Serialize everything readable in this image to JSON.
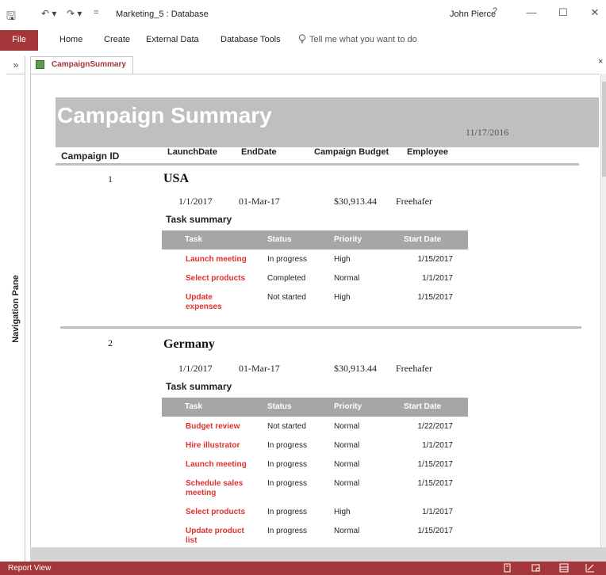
{
  "window": {
    "title": "Marketing_5 : Database",
    "user": "John Pierce",
    "help": "?",
    "minimize": "—",
    "maximize": "☐",
    "close": "✕"
  },
  "qat": {
    "save": "🖫",
    "undo": "↶ ▾",
    "redo": "↷ ▾",
    "customize": "="
  },
  "ribbon": {
    "file": "File",
    "tabs": [
      "Home",
      "Create",
      "External Data",
      "Database Tools"
    ],
    "tell_me": "Tell me what you want to do"
  },
  "nav": {
    "toggle": "»",
    "label": "Navigation Pane"
  },
  "doc_tab": {
    "label": "CampaignSummary",
    "close": "×"
  },
  "report": {
    "title": "Campaign Summary",
    "date": "11/17/2016",
    "columns": {
      "campaign_id": "Campaign ID",
      "launch_date": "LaunchDate",
      "end_date": "EndDate",
      "budget": "Campaign Budget",
      "employee": "Employee"
    },
    "task_summary_label": "Task summary",
    "task_columns": {
      "task": "Task",
      "status": "Status",
      "priority": "Priority",
      "start_date": "Start Date"
    },
    "campaigns": [
      {
        "id": "1",
        "country": "USA",
        "launch": "1/1/2017",
        "end": "01-Mar-17",
        "budget": "$30,913.44",
        "employee": "Freehafer",
        "tasks": [
          {
            "name": "Launch meeting",
            "status": "In progress",
            "priority": "High",
            "start": "1/15/2017"
          },
          {
            "name": "Select products",
            "status": "Completed",
            "priority": "Normal",
            "start": "1/1/2017"
          },
          {
            "name": "Update expenses",
            "status": "Not started",
            "priority": "High",
            "start": "1/15/2017"
          }
        ]
      },
      {
        "id": "2",
        "country": "Germany",
        "launch": "1/1/2017",
        "end": "01-Mar-17",
        "budget": "$30,913.44",
        "employee": "Freehafer",
        "tasks": [
          {
            "name": "Budget review",
            "status": "Not started",
            "priority": "Normal",
            "start": "1/22/2017"
          },
          {
            "name": "Hire illustrator",
            "status": "In progress",
            "priority": "Normal",
            "start": "1/1/2017"
          },
          {
            "name": "Launch meeting",
            "status": "In progress",
            "priority": "Normal",
            "start": "1/15/2017"
          },
          {
            "name": "Schedule sales meeting",
            "status": "In progress",
            "priority": "Normal",
            "start": "1/15/2017"
          },
          {
            "name": "Select products",
            "status": "In progress",
            "priority": "High",
            "start": "1/1/2017"
          },
          {
            "name": "Update product list",
            "status": "In progress",
            "priority": "Normal",
            "start": "1/15/2017"
          }
        ]
      }
    ]
  },
  "status_bar": {
    "text": "Report View"
  },
  "colors": {
    "accent": "#a4373a",
    "header_band": "#bfbfbf",
    "task_header": "#a6a6a6",
    "task_name": "#e03030"
  }
}
